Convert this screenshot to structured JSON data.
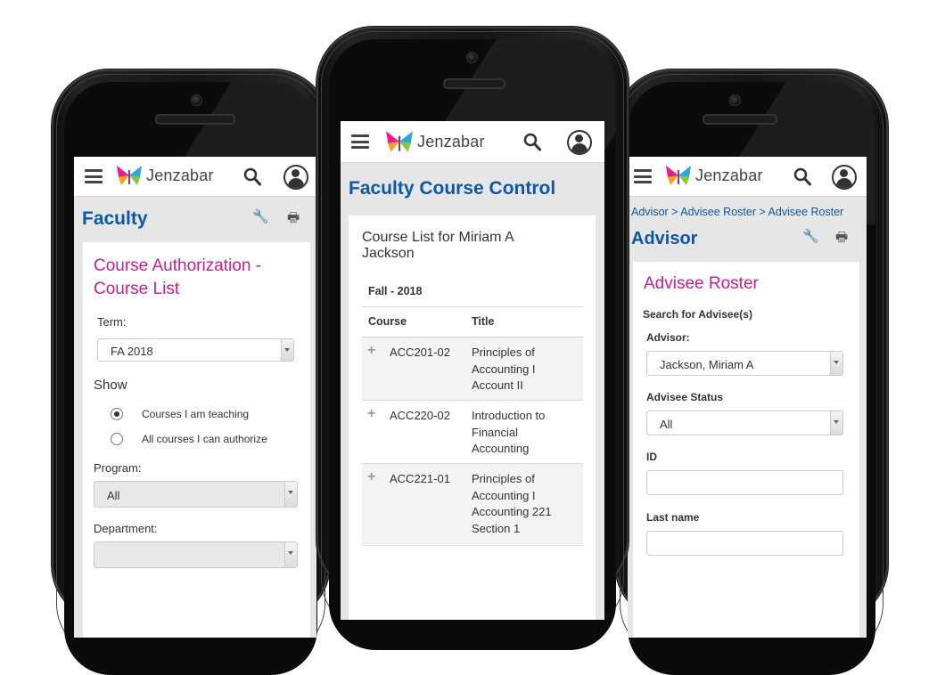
{
  "brand": {
    "name": "Jenzabar"
  },
  "colors": {
    "heading_blue": "#0d57a8",
    "magenta": "#c81e8f",
    "screen_bg": "#e6e6e6"
  },
  "icons": [
    "menu-icon",
    "search-icon",
    "user-icon",
    "wrench-icon",
    "print-icon",
    "plus-icon",
    "chevron-down-icon"
  ],
  "left": {
    "page_title": "Faculty",
    "card_title_line1": "Course Authorization -",
    "card_title_line2": "Course List",
    "term_label": "Term:",
    "term_value": "FA 2018",
    "show_label": "Show",
    "radio_teaching": "Courses I am teaching",
    "radio_authorize": "All courses I can authorize",
    "program_label": "Program:",
    "program_value": "All",
    "department_label": "Department:"
  },
  "center": {
    "page_title": "Faculty Course Control",
    "card_title_line1": "Course List for Miriam A",
    "card_title_line2": "Jackson",
    "term_heading": "Fall - 2018",
    "col_course": "Course",
    "col_title": "Title",
    "rows": [
      {
        "course": "ACC201-02",
        "title": [
          "Principles of",
          "Accounting I",
          "Account II"
        ]
      },
      {
        "course": "ACC220-02",
        "title": [
          "Introduction to",
          "Financial",
          "Accounting"
        ]
      },
      {
        "course": "ACC221-01",
        "title": [
          "Principles of",
          "Accounting I",
          "Accounting 221",
          "Section 1"
        ]
      }
    ]
  },
  "right": {
    "breadcrumb": "Advisor > Advisee Roster > Advisee Roster",
    "page_title": "Advisor",
    "card_title": "Advisee Roster",
    "search_label": "Search for Advisee(s)",
    "advisor_label": "Advisor:",
    "advisor_value": "Jackson, Miriam A",
    "status_label": "Advisee Status",
    "status_value": "All",
    "id_label": "ID",
    "lastname_label": "Last name"
  }
}
